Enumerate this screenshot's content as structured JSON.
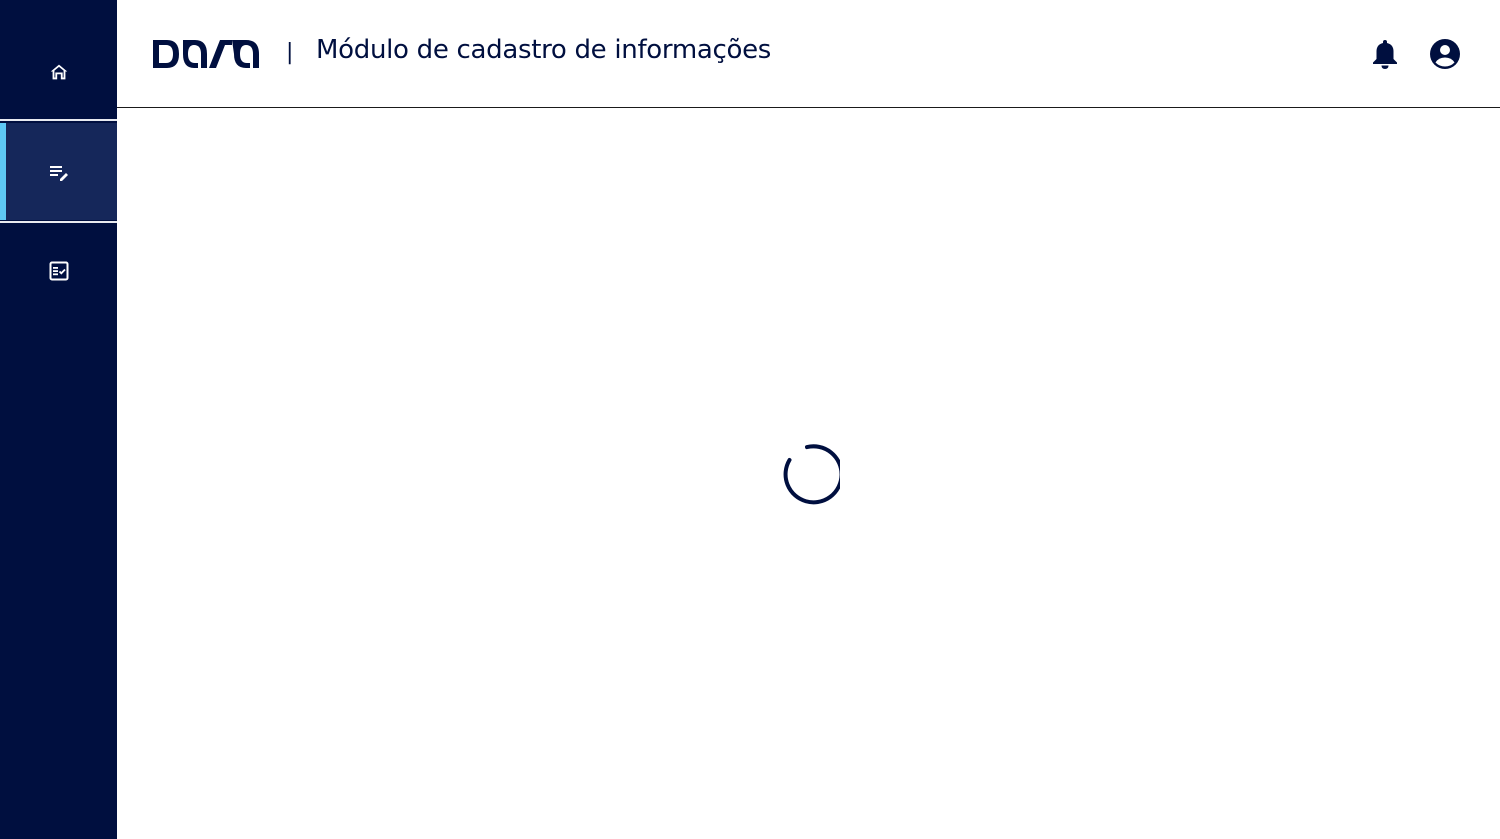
{
  "app": {
    "brand": "dasa",
    "title_separator": "|",
    "title": "Módulo de cadastro de informações"
  },
  "sidebar": {
    "items": [
      {
        "name": "home",
        "icon": "home-icon",
        "active": false
      },
      {
        "name": "cadastro",
        "icon": "edit-list-icon",
        "active": true
      },
      {
        "name": "checklist",
        "icon": "checklist-icon",
        "active": false
      }
    ]
  },
  "header": {
    "icons": [
      "bell-icon",
      "user-account-icon"
    ]
  },
  "main": {
    "state": "loading",
    "spinner_icon": "loading-spinner"
  },
  "colors": {
    "brand_navy": "#000f3f",
    "active_item_bg": "#15275a",
    "active_indicator": "#5ec9f5"
  }
}
